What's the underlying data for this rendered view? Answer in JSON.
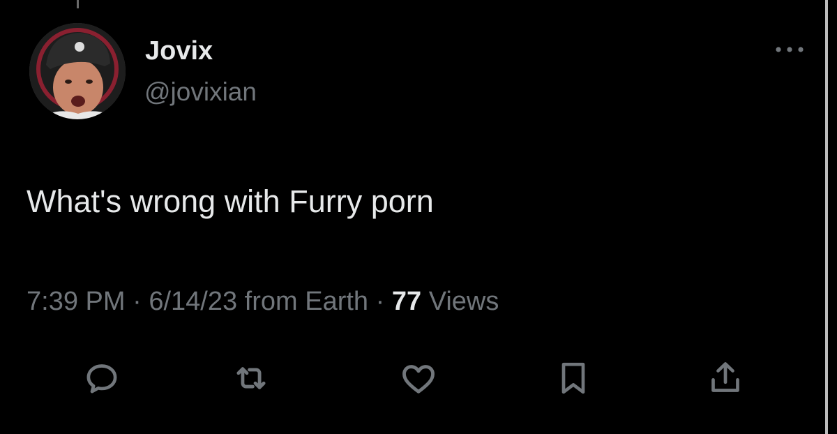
{
  "tweet": {
    "author": {
      "display_name": "Jovix",
      "handle": "@jovixian"
    },
    "text": "What's wrong with Furry porn",
    "meta": {
      "time": "7:39 PM",
      "separator": " · ",
      "date": "6/14/23",
      "source": "from Earth",
      "views_count": "77",
      "views_label": "Views"
    },
    "actions": [
      {
        "name": "reply",
        "icon": "reply-icon"
      },
      {
        "name": "retweet",
        "icon": "retweet-icon"
      },
      {
        "name": "like",
        "icon": "heart-icon"
      },
      {
        "name": "bookmark",
        "icon": "bookmark-icon"
      },
      {
        "name": "share",
        "icon": "share-icon"
      }
    ]
  },
  "colors": {
    "background": "#000000",
    "primary_text": "#e7e9ea",
    "secondary_text": "#71767b",
    "icon": "#71767b"
  }
}
